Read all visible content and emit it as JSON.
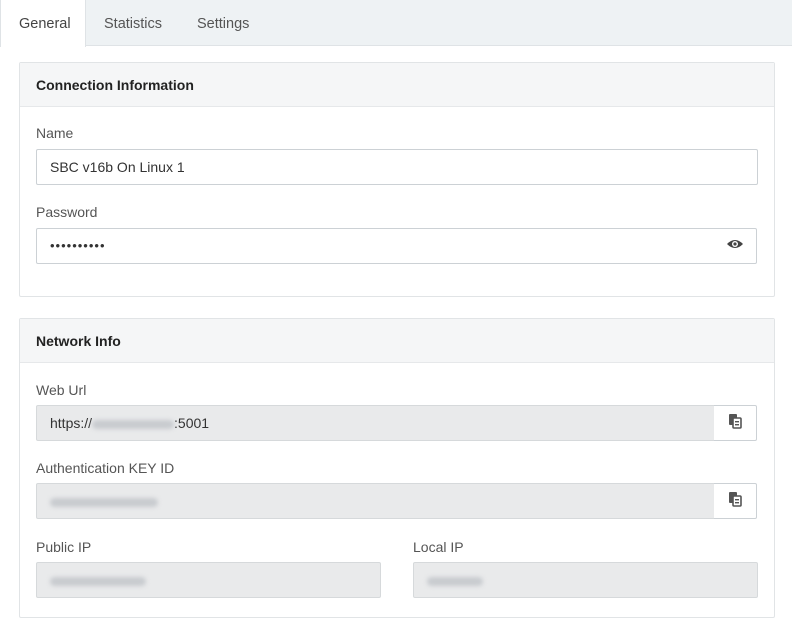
{
  "tabs": [
    {
      "label": "General",
      "active": true
    },
    {
      "label": "Statistics",
      "active": false
    },
    {
      "label": "Settings",
      "active": false
    }
  ],
  "connection": {
    "title": "Connection Information",
    "name_label": "Name",
    "name_value": "SBC v16b On Linux 1",
    "password_label": "Password",
    "password_value": "••••••••••",
    "show_password_icon": "eye-icon"
  },
  "network": {
    "title": "Network Info",
    "web_url_label": "Web Url",
    "web_url_prefix": "https://",
    "web_url_suffix": ":5001",
    "auth_key_label": "Authentication KEY ID",
    "public_ip_label": "Public IP",
    "local_ip_label": "Local IP",
    "copy_icon": "copy-icon"
  },
  "colors": {
    "tab_bar_bg": "#eef2f4",
    "panel_header_bg": "#f5f6f7",
    "readonly_bg": "#e9eaeb"
  }
}
